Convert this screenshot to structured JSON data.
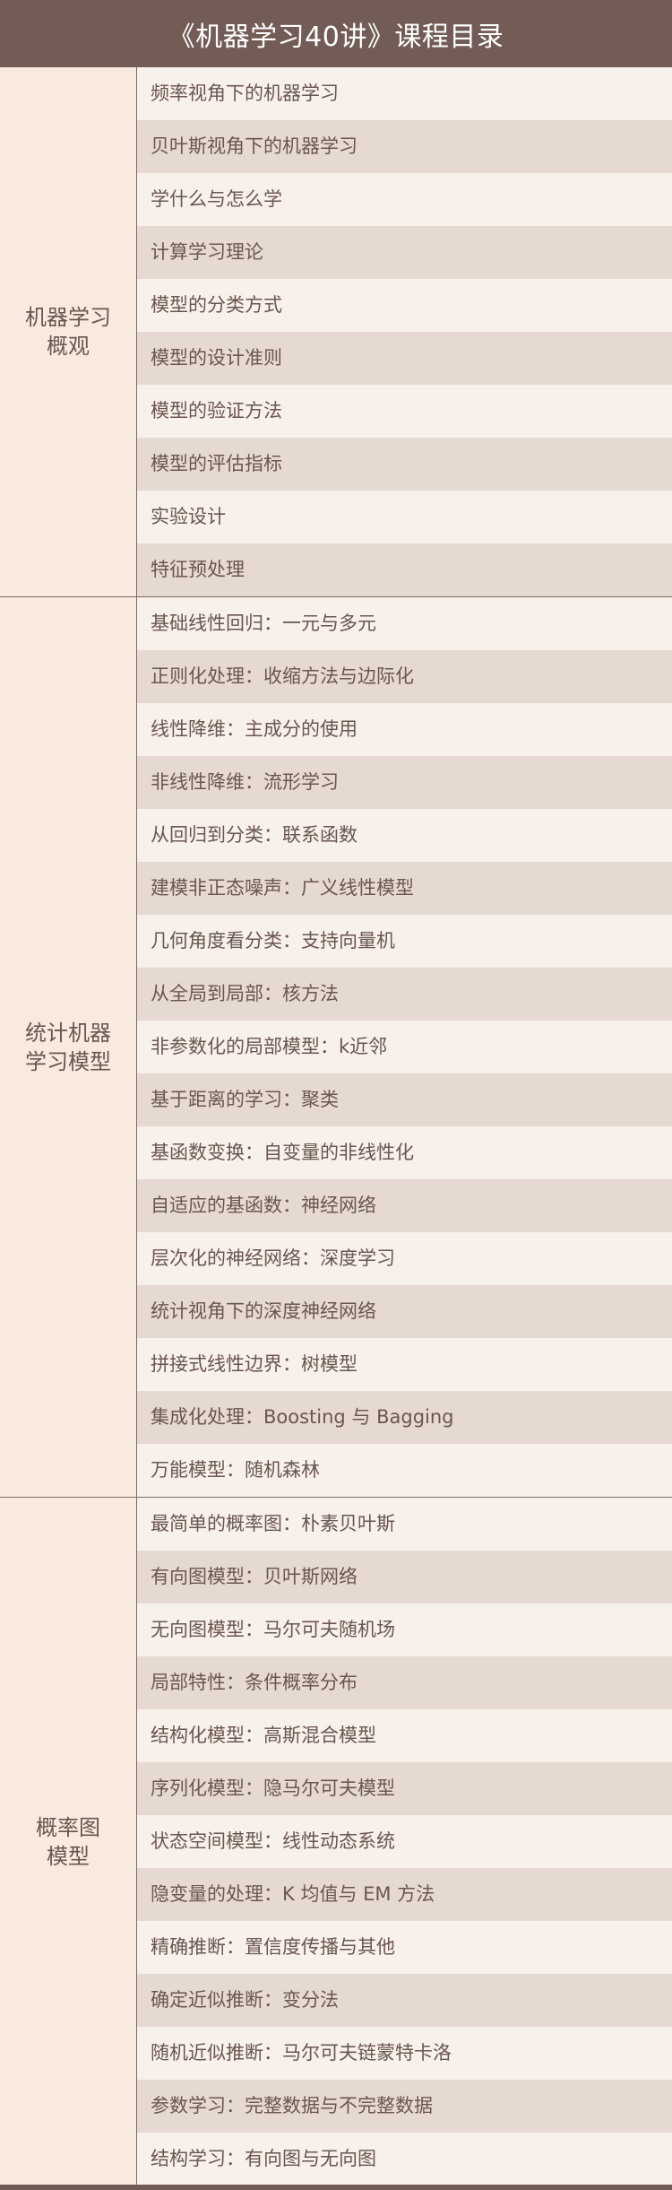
{
  "title": "《机器学习40讲》课程目录",
  "colors": {
    "header_bg": "#735c56",
    "label_bg": "#f9eadf",
    "row_light": "#f8f0ea",
    "row_dark": "#e5d9d1",
    "text": "#6a5650"
  },
  "sections": [
    {
      "label": "机器学习\n概观",
      "lessons": [
        "频率视角下的机器学习",
        "贝叶斯视角下的机器学习",
        "学什么与怎么学",
        "计算学习理论",
        "模型的分类方式",
        "模型的设计准则",
        "模型的验证方法",
        "模型的评估指标",
        "实验设计",
        "特征预处理"
      ]
    },
    {
      "label": "统计机器\n学习模型",
      "lessons": [
        "基础线性回归：一元与多元",
        "正则化处理：收缩方法与边际化",
        "线性降维：主成分的使用",
        "非线性降维：流形学习",
        "从回归到分类：联系函数",
        "建模非正态噪声：广义线性模型",
        "几何角度看分类：支持向量机",
        "从全局到局部：核方法",
        "非参数化的局部模型：k近邻",
        "基于距离的学习：聚类",
        "基函数变换：自变量的非线性化",
        "自适应的基函数：神经网络",
        "层次化的神经网络：深度学习",
        "统计视角下的深度神经网络",
        "拼接式线性边界：树模型",
        "集成化处理：Boosting 与 Bagging",
        "万能模型：随机森林"
      ]
    },
    {
      "label": "概率图\n模型",
      "lessons": [
        "最简单的概率图：朴素贝叶斯",
        "有向图模型：贝叶斯网络",
        "无向图模型：马尔可夫随机场",
        "局部特性：条件概率分布",
        "结构化模型：高斯混合模型",
        "序列化模型：隐马尔可夫模型",
        "状态空间模型：线性动态系统",
        "隐变量的处理：K 均值与 EM 方法",
        "精确推断：置信度传播与其他",
        "确定近似推断：变分法",
        "随机近似推断：马尔可夫链蒙特卡洛",
        "参数学习：完整数据与不完整数据",
        "结构学习：有向图与无向图"
      ]
    }
  ]
}
